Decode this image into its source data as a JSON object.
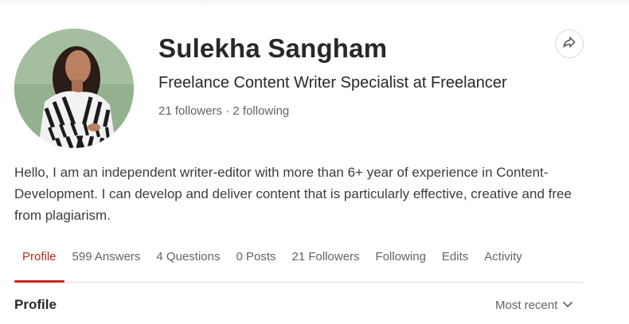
{
  "profile": {
    "name": "Sulekha Sangham",
    "headline": "Freelance Content Writer Specialist at Freelancer",
    "followers_text": "21 followers",
    "separator": " · ",
    "following_text": "2 following",
    "bio": "Hello, I am an independent writer-editor with more than 6+ year of experience in Content-Development. I can develop and deliver content that is particularly effective, creative and free from plagiarism."
  },
  "share": {
    "icon": "share-arrow-icon"
  },
  "tabs": [
    {
      "label": "Profile",
      "active": true
    },
    {
      "label": "599 Answers",
      "active": false
    },
    {
      "label": "4 Questions",
      "active": false
    },
    {
      "label": "0 Posts",
      "active": false
    },
    {
      "label": "21 Followers",
      "active": false
    },
    {
      "label": "Following",
      "active": false
    },
    {
      "label": "Edits",
      "active": false
    },
    {
      "label": "Activity",
      "active": false
    }
  ],
  "section": {
    "title": "Profile",
    "sort_label": "Most recent",
    "sort_icon": "chevron-down-icon"
  },
  "colors": {
    "accent": "#b92b27",
    "text": "#282829",
    "muted": "#636466"
  }
}
